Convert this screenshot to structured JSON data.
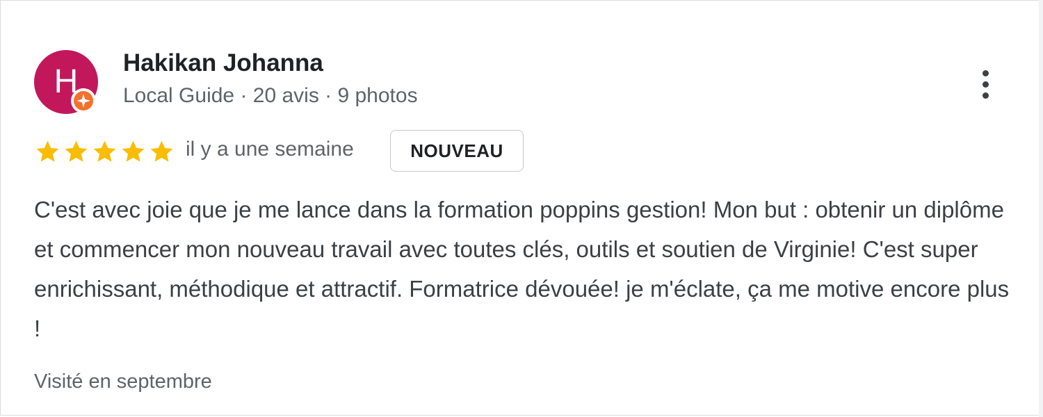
{
  "reviewer": {
    "initial": "H",
    "name": "Hakikan Johanna",
    "meta": "Local Guide · 20 avis · 9 photos",
    "avatar_color": "#c2185b",
    "badge_icon": "local-guide-star-icon",
    "badge_color": "#f4702b"
  },
  "review": {
    "rating": 5,
    "max_rating": 5,
    "star_color": "#fbbc04",
    "time": "il y a une semaine",
    "new_badge": "NOUVEAU",
    "text": "C'est avec joie que je me lance dans la formation poppins gestion! Mon but : obtenir un diplôme et commencer mon nouveau travail avec toutes clés, outils et soutien de Virginie! C'est super enrichissant, méthodique et attractif. Formatrice dévouée! je m'éclate, ça me motive encore plus !",
    "visit": "Visité en septembre"
  },
  "actions": {
    "more_icon": "more-vert-icon"
  }
}
